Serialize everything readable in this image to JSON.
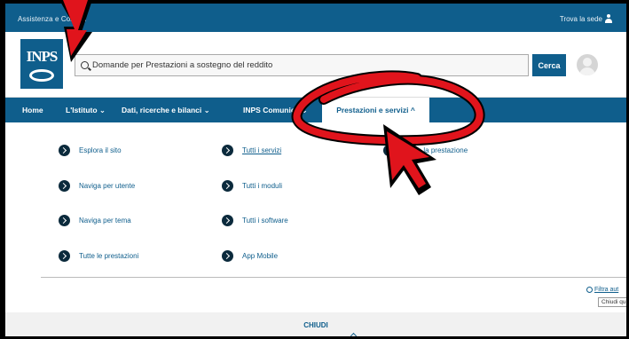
{
  "topbar": {
    "left_text": "Assistenza e Contatti",
    "right_text": "Trova la sede"
  },
  "logo": {
    "text": "INPS"
  },
  "search": {
    "value": "Domande per Prestazioni a sostegno del reddito",
    "button_label": "Cerca"
  },
  "nav": {
    "items": [
      {
        "label": "Home"
      },
      {
        "label": "L'Istituto ⌄"
      },
      {
        "label": "Dati, ricerche e bilanci ⌄"
      },
      {
        "label": "INPS Comunica ⌄"
      }
    ],
    "active": {
      "label": "Prestazioni e servizi ^"
    }
  },
  "menu": {
    "col1": [
      "Esplora il sito",
      "Naviga per utente",
      "Naviga per tema",
      "Tutte le prestazioni"
    ],
    "col2": [
      "Tutti i servizi",
      "Tutti i moduli",
      "Tutti i software",
      "App Mobile"
    ],
    "col3": [
      "Trova la prestazione"
    ]
  },
  "filter": {
    "label": "Filtra aut",
    "tooltip": "Chiudi qui"
  },
  "footer": {
    "close_label": "CHIUDI"
  },
  "colors": {
    "primary": "#0f5e8c",
    "annotation": "#e0141c"
  }
}
